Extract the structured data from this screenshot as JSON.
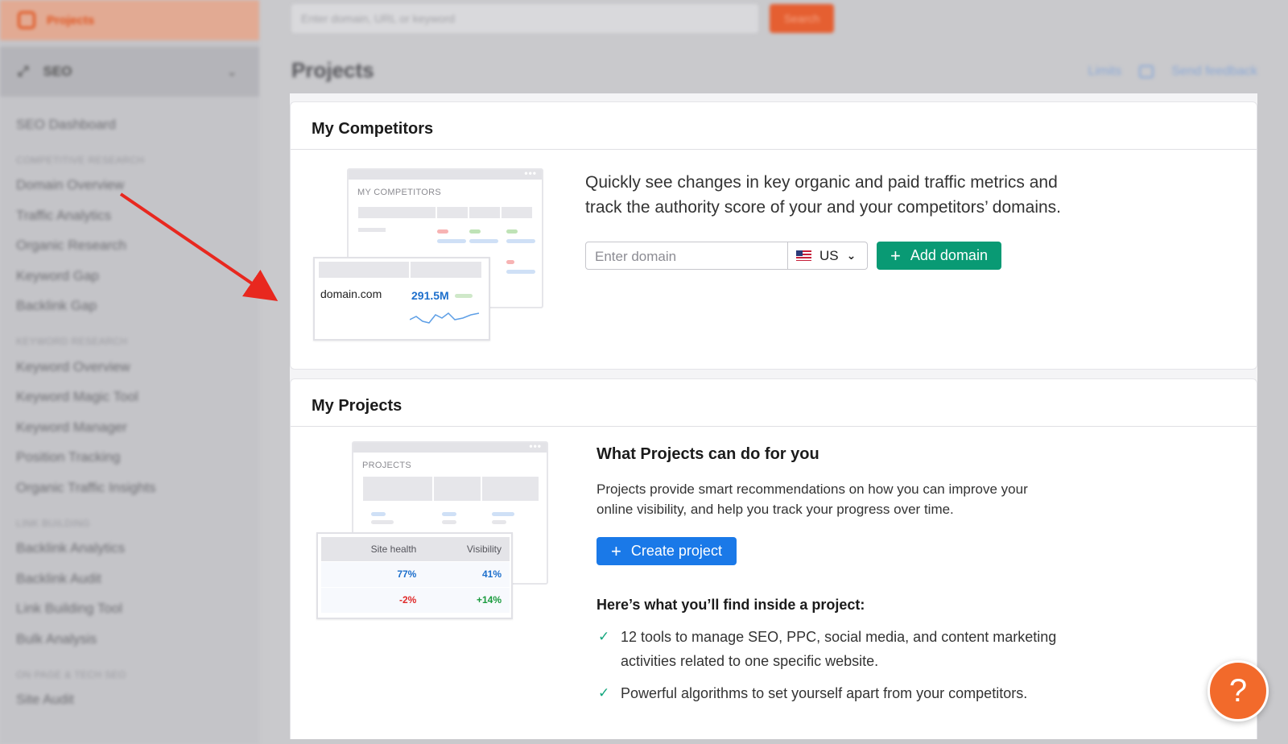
{
  "sidebar": {
    "projects_label": "Projects",
    "seo_label": "SEO",
    "items": [
      {
        "type": "item",
        "label": "SEO Dashboard"
      },
      {
        "type": "heading",
        "label": "COMPETITIVE RESEARCH"
      },
      {
        "type": "item",
        "label": "Domain Overview"
      },
      {
        "type": "item",
        "label": "Traffic Analytics"
      },
      {
        "type": "item",
        "label": "Organic Research"
      },
      {
        "type": "item",
        "label": "Keyword Gap"
      },
      {
        "type": "item",
        "label": "Backlink Gap"
      },
      {
        "type": "heading",
        "label": "KEYWORD RESEARCH"
      },
      {
        "type": "item",
        "label": "Keyword Overview"
      },
      {
        "type": "item",
        "label": "Keyword Magic Tool"
      },
      {
        "type": "item",
        "label": "Keyword Manager"
      },
      {
        "type": "item",
        "label": "Position Tracking"
      },
      {
        "type": "item",
        "label": "Organic Traffic Insights"
      },
      {
        "type": "heading",
        "label": "LINK BUILDING"
      },
      {
        "type": "item",
        "label": "Backlink Analytics"
      },
      {
        "type": "item",
        "label": "Backlink Audit"
      },
      {
        "type": "item",
        "label": "Link Building Tool"
      },
      {
        "type": "item",
        "label": "Bulk Analysis"
      },
      {
        "type": "heading",
        "label": "ON PAGE & TECH SEO"
      },
      {
        "type": "item",
        "label": "Site Audit"
      }
    ]
  },
  "topbar": {
    "search_placeholder": "Enter domain, URL or keyword",
    "search_button": "Search"
  },
  "page": {
    "title": "Projects",
    "limits_link": "Limits",
    "feedback_link": "Send feedback"
  },
  "competitors": {
    "title": "My Competitors",
    "illustration": {
      "window_title": "MY COMPETITORS",
      "domain": "domain.com",
      "value": "291.5M"
    },
    "description_line1": "Quickly see changes in key organic and paid traffic metrics and",
    "description_line2": "track the authority score of your and your competitors’ domains.",
    "domain_placeholder": "Enter domain",
    "country": "US",
    "add_button": "Add domain"
  },
  "projects": {
    "title": "My Projects",
    "illustration": {
      "window_title": "PROJECTS",
      "table_headers": [
        "Site health",
        "Visibility"
      ],
      "table_rows": [
        [
          "77%",
          "41%"
        ],
        [
          "-2%",
          "+14%"
        ]
      ]
    },
    "subtitle": "What Projects can do for you",
    "description_line1": "Projects provide smart recommendations on how you can improve your",
    "description_line2": "online visibility, and help you track your progress over time.",
    "create_button": "Create project",
    "inside_heading": "Here’s what you’ll find inside a project:",
    "features": [
      "12 tools to manage SEO, PPC, social media, and content marketing activities related to one specific website.",
      "Powerful algorithms to set yourself apart from your competitors."
    ]
  },
  "help": {
    "label": "?"
  },
  "colors": {
    "green": "#099a74",
    "blue": "#1a79e8",
    "orange": "#f26a2b",
    "arrow_red": "#e8281f"
  }
}
